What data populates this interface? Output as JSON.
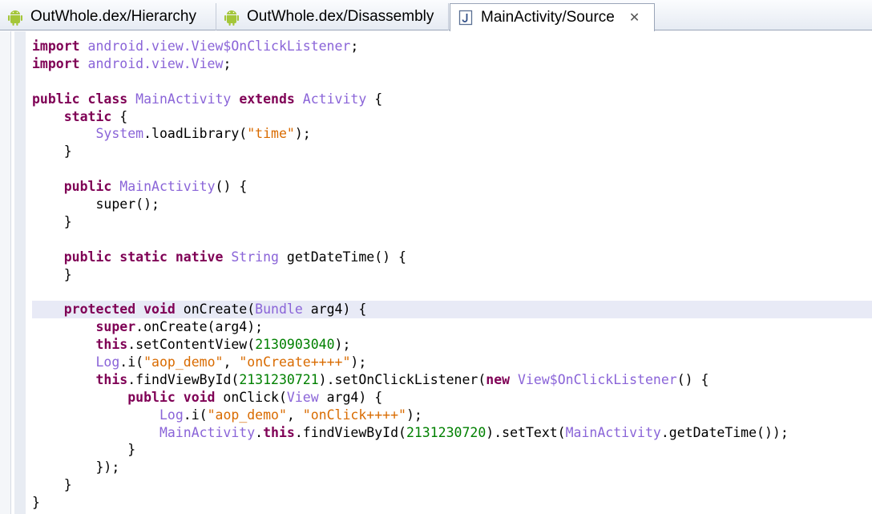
{
  "tabs": [
    {
      "label": "OutWhole.dex/Hierarchy",
      "icon": "android-icon",
      "active": false
    },
    {
      "label": "OutWhole.dex/Disassembly",
      "icon": "android-icon",
      "active": false
    },
    {
      "label": "MainActivity/Source",
      "icon": "java-file-icon",
      "active": true,
      "close": "✕"
    }
  ],
  "code_lines": [
    [
      [
        "kw",
        "import"
      ],
      [
        "",
        " "
      ],
      [
        "ty",
        "android.view.View$OnClickListener"
      ],
      [
        "",
        ";"
      ]
    ],
    [
      [
        "kw",
        "import"
      ],
      [
        "",
        " "
      ],
      [
        "ty",
        "android.view.View"
      ],
      [
        "",
        ";"
      ]
    ],
    [],
    [
      [
        "kw",
        "public class"
      ],
      [
        "",
        " "
      ],
      [
        "ty",
        "MainActivity"
      ],
      [
        "",
        " "
      ],
      [
        "kw",
        "extends"
      ],
      [
        "",
        " "
      ],
      [
        "ty",
        "Activity"
      ],
      [
        "",
        " {"
      ]
    ],
    [
      [
        "",
        "    "
      ],
      [
        "kw",
        "static"
      ],
      [
        "",
        " {"
      ]
    ],
    [
      [
        "",
        "        "
      ],
      [
        "ty",
        "System"
      ],
      [
        "",
        ".loadLibrary("
      ],
      [
        "st",
        "\"time\""
      ],
      [
        "",
        ");"
      ]
    ],
    [
      [
        "",
        "    }"
      ]
    ],
    [],
    [
      [
        "",
        "    "
      ],
      [
        "kw",
        "public"
      ],
      [
        "",
        " "
      ],
      [
        "ty",
        "MainActivity"
      ],
      [
        "",
        "() {"
      ]
    ],
    [
      [
        "",
        "        super();"
      ]
    ],
    [
      [
        "",
        "    }"
      ]
    ],
    [],
    [
      [
        "",
        "    "
      ],
      [
        "kw",
        "public static native"
      ],
      [
        "",
        " "
      ],
      [
        "ty",
        "String"
      ],
      [
        "",
        " getDateTime() {"
      ]
    ],
    [
      [
        "",
        "    }"
      ]
    ],
    [],
    [
      [
        "",
        "    "
      ],
      [
        "kw",
        "protected void"
      ],
      [
        "",
        " onCreate("
      ],
      [
        "ty",
        "Bundle"
      ],
      [
        "",
        " arg4) {"
      ]
    ],
    [
      [
        "",
        "        "
      ],
      [
        "kw",
        "super"
      ],
      [
        "",
        ".onCreate(arg4);"
      ]
    ],
    [
      [
        "",
        "        "
      ],
      [
        "kw",
        "this"
      ],
      [
        "",
        ".setContentView("
      ],
      [
        "nu",
        "2130903040"
      ],
      [
        "",
        ");"
      ]
    ],
    [
      [
        "",
        "        "
      ],
      [
        "ty",
        "Log"
      ],
      [
        "",
        ".i("
      ],
      [
        "st",
        "\"aop_demo\""
      ],
      [
        "",
        ", "
      ],
      [
        "st",
        "\"onCreate++++\""
      ],
      [
        "",
        ");"
      ]
    ],
    [
      [
        "",
        "        "
      ],
      [
        "kw",
        "this"
      ],
      [
        "",
        ".findViewById("
      ],
      [
        "nu",
        "2131230721"
      ],
      [
        "",
        ").setOnClickListener("
      ],
      [
        "kw",
        "new"
      ],
      [
        "",
        " "
      ],
      [
        "ty",
        "View$OnClickListener"
      ],
      [
        "",
        "() {"
      ]
    ],
    [
      [
        "",
        "            "
      ],
      [
        "kw",
        "public void"
      ],
      [
        "",
        " onClick("
      ],
      [
        "ty",
        "View"
      ],
      [
        "",
        " arg4) {"
      ]
    ],
    [
      [
        "",
        "                "
      ],
      [
        "ty",
        "Log"
      ],
      [
        "",
        ".i("
      ],
      [
        "st",
        "\"aop_demo\""
      ],
      [
        "",
        ", "
      ],
      [
        "st",
        "\"onClick++++\""
      ],
      [
        "",
        ");"
      ]
    ],
    [
      [
        "",
        "                "
      ],
      [
        "ty",
        "MainActivity"
      ],
      [
        "",
        "."
      ],
      [
        "kw",
        "this"
      ],
      [
        "",
        ".findViewById("
      ],
      [
        "nu",
        "2131230720"
      ],
      [
        "",
        ").setText("
      ],
      [
        "ty",
        "MainActivity"
      ],
      [
        "",
        ".getDateTime());"
      ]
    ],
    [
      [
        "",
        "            }"
      ]
    ],
    [
      [
        "",
        "        });"
      ]
    ],
    [
      [
        "",
        "    }"
      ]
    ],
    [
      [
        "",
        "}"
      ]
    ]
  ],
  "highlighted_line": 15
}
